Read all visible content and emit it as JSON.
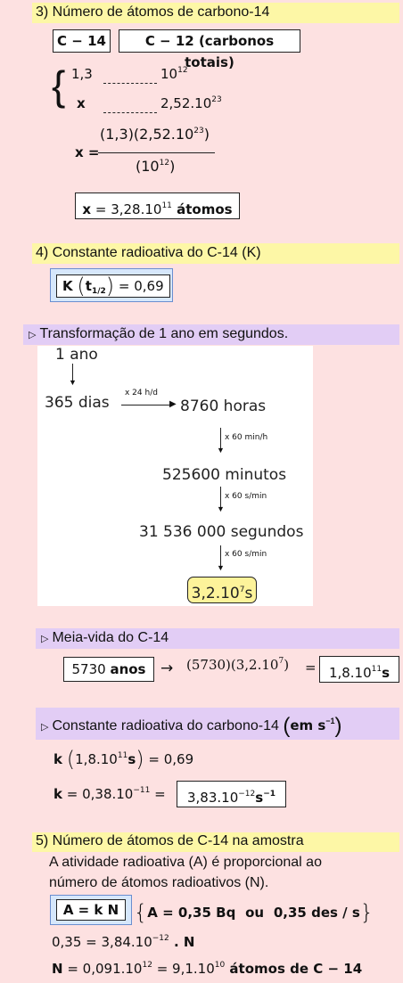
{
  "s3": {
    "title": "3) Número de átomos de carbono-14",
    "box_c14": "C − 14",
    "box_c12": "C − 12 (carbonos totais)",
    "sys_l1": "1,3",
    "sys_r1a": "10",
    "sys_r1e": "12",
    "sys_l2": "x",
    "sys_r2a": "2,52.10",
    "sys_r2e": "23",
    "eq_lhs": "x =",
    "eq_num_a": "(1,3)(2,52.10",
    "eq_num_e": "23",
    "eq_num_c": ")",
    "eq_den_a": "(10",
    "eq_den_e": "12",
    "eq_den_c": ")",
    "result_a": "x",
    "result_b": " = 3,28.10",
    "result_e": "11",
    "result_c": " átomos"
  },
  "s4": {
    "title": "4) Constante radioativa do C-14 (K)",
    "k_a": "K",
    "k_t": "t",
    "k_sub": "1/2",
    "k_c": " = 0,69"
  },
  "conv": {
    "title": "Transformação de 1 ano em segundos.",
    "one_year": "1 ano",
    "days": "365 dias",
    "arrow1": "x 24 h/d",
    "hours": "8760 horas",
    "arrow2": "x 60 min/h",
    "minutes": "525600 minutos",
    "arrow3": "x 60 s/min",
    "seconds": "31  536  000 segundos",
    "arrow4": "x 60 s/min",
    "result_a": "3,2.10",
    "result_e": "7",
    "result_c": "s"
  },
  "half_life": {
    "title": "Meia-vida do C-14",
    "box_a": "5730 ",
    "box_b": "anos",
    "arrow": "→",
    "mid_a": "(5730)(3,2.10",
    "mid_e": "7",
    "mid_c": ")",
    "eq": "=",
    "result_a": "1,8.10",
    "result_e": "11",
    "result_c": "s"
  },
  "const": {
    "title_a": "Constante radioativa do carbono-14 ",
    "title_b": "em s",
    "title_e": "−1",
    "l1_a": "k",
    "l1_b": "1,8.10",
    "l1_e": "11",
    "l1_c": "s",
    "l1_d": " = 0,69",
    "l2_a": "k",
    "l2_b": " = 0,38.10",
    "l2_e": "−11",
    "l2_c": " = ",
    "res_a": "3,83.10",
    "res_e": "−12",
    "res_c": "s",
    "res_e2": "−1"
  },
  "s5": {
    "title": "5) Número de átomos de C-14 na amostra",
    "p1": "A atividade radioativa (A) é proporcional ao",
    "p2": "número de átomos radioativos (N).",
    "box": "A = k N",
    "brace_a": "A = 0,35 Bq",
    "brace_b": "ou",
    "brace_c": "0,35 des / s",
    "l3_a": "0,35  =  3,84.10",
    "l3_e": "−12",
    "l3_c": "  .  N",
    "l4_a": "N",
    "l4_b": " = 0,091.10",
    "l4_e": "12",
    "l4_c": " =  9,1.10",
    "l4_e2": "10",
    "l4_d": " átomos de C − 14"
  }
}
